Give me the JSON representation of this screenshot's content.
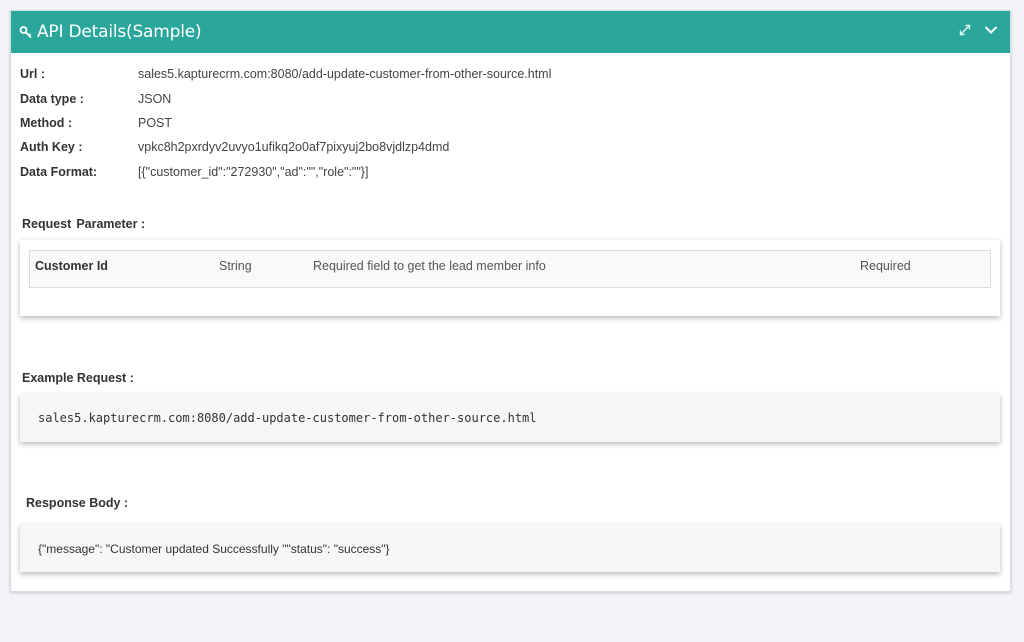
{
  "panel": {
    "title": "API Details(Sample)",
    "header_color": "#2aa79a",
    "icons": {
      "title": "key-icon",
      "expand": "expand-icon",
      "collapse": "chevron-down-icon"
    }
  },
  "details": [
    {
      "label": "Url :",
      "value": "sales5.kapturecrm.com:8080/add-update-customer-from-other-source.html"
    },
    {
      "label": "Data type :",
      "value": "JSON"
    },
    {
      "label": "Method :",
      "value": "POST"
    },
    {
      "label": "Auth Key :",
      "value": "vpkc8h2pxrdyv2uvyo1ufikq2o0af7pixyuj2bo8vjdlzp4dmd"
    },
    {
      "label": "Data Format:",
      "value": "[{\"customer_id\":\"272930\",\"ad\":\"\",\"role\":\"\"}]"
    }
  ],
  "request_parameter": {
    "title_part1": "Request",
    "title_part2": "Parameter :",
    "rows": [
      {
        "name": "Customer Id",
        "type": "String",
        "description": "Required field to get the lead member info",
        "required": "Required"
      }
    ]
  },
  "example_request": {
    "title": "Example Request :",
    "text": "sales5.kapturecrm.com:8080/add-update-customer-from-other-source.html"
  },
  "response_body": {
    "title": "Response Body :",
    "text": "{\"message\": \"Customer updated Successfully \"\"status\": \"success\"}"
  }
}
